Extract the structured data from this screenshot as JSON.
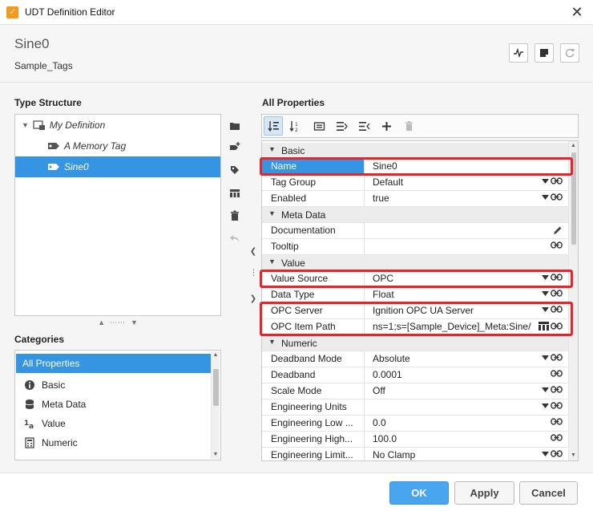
{
  "window": {
    "title": "UDT Definition Editor",
    "close_glyph": "✕"
  },
  "header": {
    "tag_name": "Sine0",
    "provider": "Sample_Tags"
  },
  "type_structure": {
    "label": "Type Structure",
    "items": [
      {
        "label": "My Definition",
        "icon": "udt-definition-icon"
      },
      {
        "label": "A Memory Tag",
        "icon": "memory-tag-icon"
      },
      {
        "label": "Sine0",
        "icon": "opc-tag-icon",
        "selected": true
      }
    ]
  },
  "categories": {
    "label": "Categories",
    "items": [
      {
        "label": "All Properties",
        "selected": true
      },
      {
        "label": "Basic",
        "icon": "info-icon"
      },
      {
        "label": "Meta Data",
        "icon": "database-icon"
      },
      {
        "label": "Value",
        "icon": "value-type-icon"
      },
      {
        "label": "Numeric",
        "icon": "calculator-icon"
      }
    ]
  },
  "all_properties": {
    "label": "All Properties",
    "sections": {
      "basic": "Basic",
      "meta_data": "Meta Data",
      "value": "Value",
      "numeric": "Numeric"
    },
    "rows": {
      "name": {
        "label": "Name",
        "value": "Sine0"
      },
      "tag_group": {
        "label": "Tag Group",
        "value": "Default"
      },
      "enabled": {
        "label": "Enabled",
        "value": "true"
      },
      "documentation": {
        "label": "Documentation",
        "value": ""
      },
      "tooltip": {
        "label": "Tooltip",
        "value": ""
      },
      "value_source": {
        "label": "Value Source",
        "value": "OPC"
      },
      "data_type": {
        "label": "Data Type",
        "value": "Float"
      },
      "opc_server": {
        "label": "OPC Server",
        "value": "Ignition OPC UA Server"
      },
      "opc_item_path": {
        "label": "OPC Item Path",
        "value": "ns=1;s=[Sample_Device]_Meta:Sine/"
      },
      "deadband_mode": {
        "label": "Deadband Mode",
        "value": "Absolute"
      },
      "deadband": {
        "label": "Deadband",
        "value": "0.0001"
      },
      "scale_mode": {
        "label": "Scale Mode",
        "value": "Off"
      },
      "engineering_units": {
        "label": "Engineering Units",
        "value": ""
      },
      "engineering_low": {
        "label": "Engineering Low ...",
        "value": "0.0"
      },
      "engineering_high": {
        "label": "Engineering High...",
        "value": "100.0"
      },
      "engineering_limit": {
        "label": "Engineering Limit...",
        "value": "No Clamp"
      }
    }
  },
  "footer": {
    "ok": "OK",
    "apply": "Apply",
    "cancel": "Cancel"
  },
  "colors": {
    "selection": "#3595e3",
    "highlight": "#e0262f",
    "primary_button": "#4aa5ef"
  }
}
